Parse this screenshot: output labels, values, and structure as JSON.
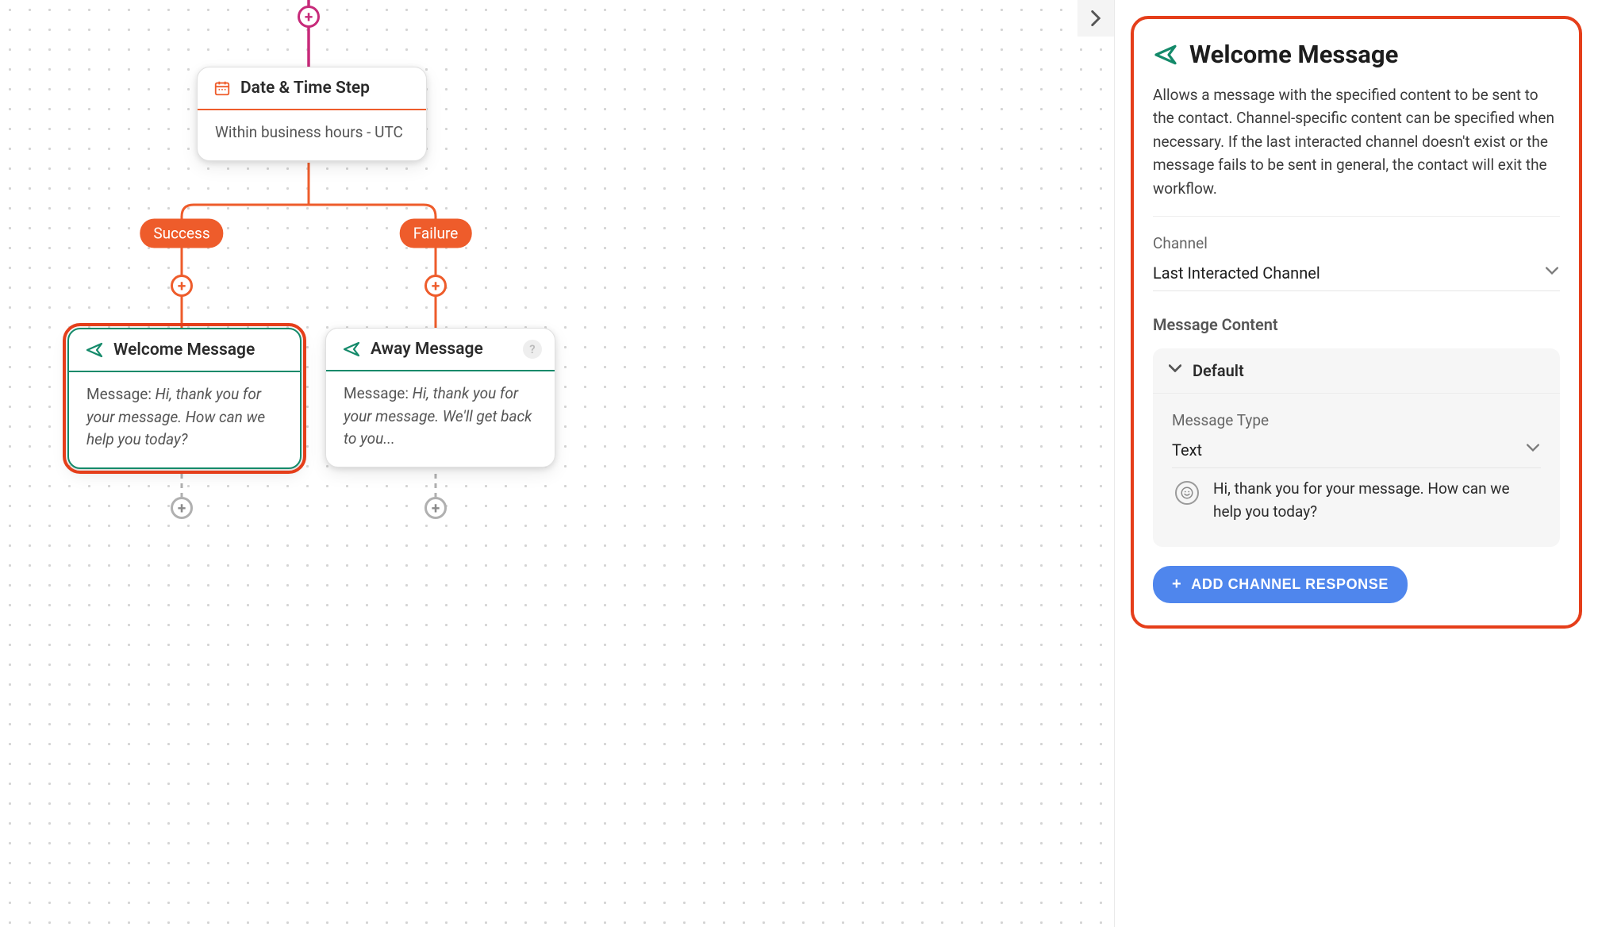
{
  "canvas": {
    "datetime_node": {
      "title": "Date & Time Step",
      "description": "Within business hours - UTC"
    },
    "branches": {
      "success_label": "Success",
      "failure_label": "Failure"
    },
    "welcome_node": {
      "title": "Welcome Message",
      "body_prefix": "Message: ",
      "body_text": "Hi, thank you for your message. How can we help you today?"
    },
    "away_node": {
      "title": "Away Message",
      "body_prefix": "Message: ",
      "body_text": "Hi, thank you for your message. We'll get back to you...",
      "help_glyph": "?"
    }
  },
  "panel": {
    "title": "Welcome Message",
    "description": "Allows a message with the specified content to be sent to the contact. Channel-specific content can be specified when necessary. If the last interacted channel doesn't exist or the message fails to be sent in general, the contact will exit the workflow.",
    "channel": {
      "label": "Channel",
      "selected": "Last Interacted Channel"
    },
    "message_content": {
      "section_title": "Message Content",
      "accordion_title": "Default",
      "type_label": "Message Type",
      "type_selected": "Text",
      "text_value": "Hi, thank you for your message. How can we help you today?"
    },
    "add_channel_button": "ADD CHANNEL RESPONSE"
  }
}
